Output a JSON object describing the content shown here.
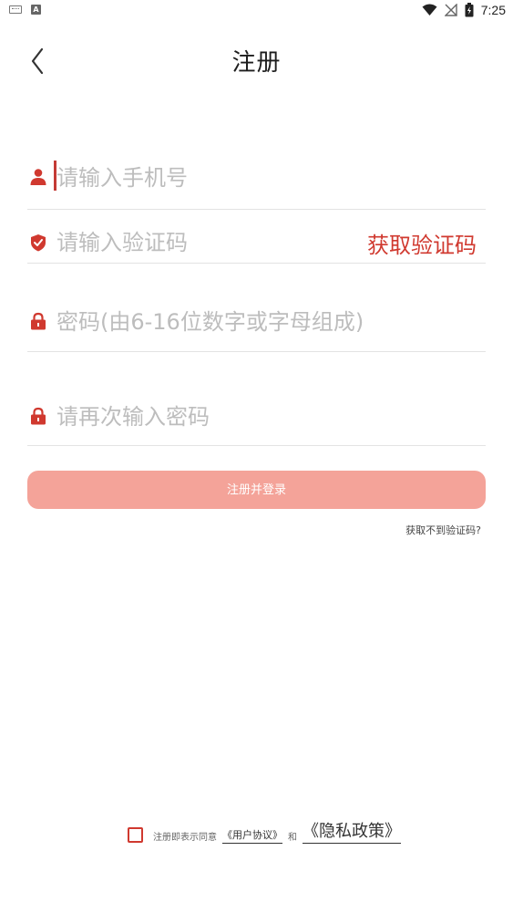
{
  "status_bar": {
    "time": "7:25",
    "notification_a": "A"
  },
  "header": {
    "title": "注册"
  },
  "form": {
    "phone_placeholder": "请输入手机号",
    "code_placeholder": "请输入验证码",
    "get_code_label": "获取验证码",
    "password_placeholder": "密码(由6-16位数字或字母组成)",
    "password_confirm_placeholder": "请再次输入密码",
    "submit_label": "注册并登录",
    "no_code_link": "获取不到验证码?"
  },
  "agreement": {
    "prefix": "注册即表示同意",
    "user_agreement": "《用户协议》",
    "and": "和",
    "privacy_policy": "《隐私政策》",
    "checked": false
  },
  "colors": {
    "accent": "#d0392f",
    "button_bg": "#f4a399",
    "placeholder": "#bdbdbd",
    "divider": "#e3e3e3"
  },
  "icons": {
    "phone_field": "user-icon",
    "code_field": "shield-check-icon",
    "password_field": "lock-icon",
    "password_confirm_field": "lock-icon"
  }
}
